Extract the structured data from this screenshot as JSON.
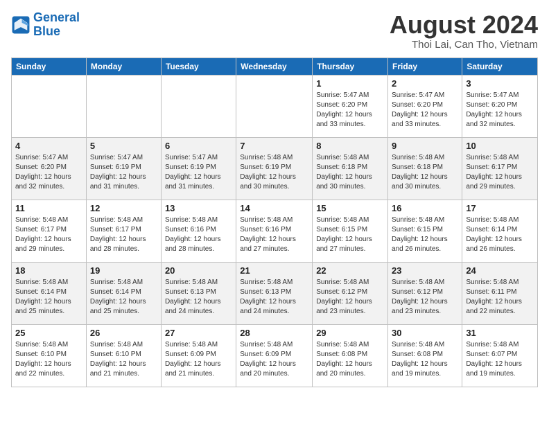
{
  "header": {
    "logo_line1": "General",
    "logo_line2": "Blue",
    "month_year": "August 2024",
    "location": "Thoi Lai, Can Tho, Vietnam"
  },
  "days_of_week": [
    "Sunday",
    "Monday",
    "Tuesday",
    "Wednesday",
    "Thursday",
    "Friday",
    "Saturday"
  ],
  "weeks": [
    [
      {
        "day": "",
        "info": ""
      },
      {
        "day": "",
        "info": ""
      },
      {
        "day": "",
        "info": ""
      },
      {
        "day": "",
        "info": ""
      },
      {
        "day": "1",
        "info": "Sunrise: 5:47 AM\nSunset: 6:20 PM\nDaylight: 12 hours\nand 33 minutes."
      },
      {
        "day": "2",
        "info": "Sunrise: 5:47 AM\nSunset: 6:20 PM\nDaylight: 12 hours\nand 33 minutes."
      },
      {
        "day": "3",
        "info": "Sunrise: 5:47 AM\nSunset: 6:20 PM\nDaylight: 12 hours\nand 32 minutes."
      }
    ],
    [
      {
        "day": "4",
        "info": "Sunrise: 5:47 AM\nSunset: 6:20 PM\nDaylight: 12 hours\nand 32 minutes."
      },
      {
        "day": "5",
        "info": "Sunrise: 5:47 AM\nSunset: 6:19 PM\nDaylight: 12 hours\nand 31 minutes."
      },
      {
        "day": "6",
        "info": "Sunrise: 5:47 AM\nSunset: 6:19 PM\nDaylight: 12 hours\nand 31 minutes."
      },
      {
        "day": "7",
        "info": "Sunrise: 5:48 AM\nSunset: 6:19 PM\nDaylight: 12 hours\nand 30 minutes."
      },
      {
        "day": "8",
        "info": "Sunrise: 5:48 AM\nSunset: 6:18 PM\nDaylight: 12 hours\nand 30 minutes."
      },
      {
        "day": "9",
        "info": "Sunrise: 5:48 AM\nSunset: 6:18 PM\nDaylight: 12 hours\nand 30 minutes."
      },
      {
        "day": "10",
        "info": "Sunrise: 5:48 AM\nSunset: 6:17 PM\nDaylight: 12 hours\nand 29 minutes."
      }
    ],
    [
      {
        "day": "11",
        "info": "Sunrise: 5:48 AM\nSunset: 6:17 PM\nDaylight: 12 hours\nand 29 minutes."
      },
      {
        "day": "12",
        "info": "Sunrise: 5:48 AM\nSunset: 6:17 PM\nDaylight: 12 hours\nand 28 minutes."
      },
      {
        "day": "13",
        "info": "Sunrise: 5:48 AM\nSunset: 6:16 PM\nDaylight: 12 hours\nand 28 minutes."
      },
      {
        "day": "14",
        "info": "Sunrise: 5:48 AM\nSunset: 6:16 PM\nDaylight: 12 hours\nand 27 minutes."
      },
      {
        "day": "15",
        "info": "Sunrise: 5:48 AM\nSunset: 6:15 PM\nDaylight: 12 hours\nand 27 minutes."
      },
      {
        "day": "16",
        "info": "Sunrise: 5:48 AM\nSunset: 6:15 PM\nDaylight: 12 hours\nand 26 minutes."
      },
      {
        "day": "17",
        "info": "Sunrise: 5:48 AM\nSunset: 6:14 PM\nDaylight: 12 hours\nand 26 minutes."
      }
    ],
    [
      {
        "day": "18",
        "info": "Sunrise: 5:48 AM\nSunset: 6:14 PM\nDaylight: 12 hours\nand 25 minutes."
      },
      {
        "day": "19",
        "info": "Sunrise: 5:48 AM\nSunset: 6:14 PM\nDaylight: 12 hours\nand 25 minutes."
      },
      {
        "day": "20",
        "info": "Sunrise: 5:48 AM\nSunset: 6:13 PM\nDaylight: 12 hours\nand 24 minutes."
      },
      {
        "day": "21",
        "info": "Sunrise: 5:48 AM\nSunset: 6:13 PM\nDaylight: 12 hours\nand 24 minutes."
      },
      {
        "day": "22",
        "info": "Sunrise: 5:48 AM\nSunset: 6:12 PM\nDaylight: 12 hours\nand 23 minutes."
      },
      {
        "day": "23",
        "info": "Sunrise: 5:48 AM\nSunset: 6:12 PM\nDaylight: 12 hours\nand 23 minutes."
      },
      {
        "day": "24",
        "info": "Sunrise: 5:48 AM\nSunset: 6:11 PM\nDaylight: 12 hours\nand 22 minutes."
      }
    ],
    [
      {
        "day": "25",
        "info": "Sunrise: 5:48 AM\nSunset: 6:10 PM\nDaylight: 12 hours\nand 22 minutes."
      },
      {
        "day": "26",
        "info": "Sunrise: 5:48 AM\nSunset: 6:10 PM\nDaylight: 12 hours\nand 21 minutes."
      },
      {
        "day": "27",
        "info": "Sunrise: 5:48 AM\nSunset: 6:09 PM\nDaylight: 12 hours\nand 21 minutes."
      },
      {
        "day": "28",
        "info": "Sunrise: 5:48 AM\nSunset: 6:09 PM\nDaylight: 12 hours\nand 20 minutes."
      },
      {
        "day": "29",
        "info": "Sunrise: 5:48 AM\nSunset: 6:08 PM\nDaylight: 12 hours\nand 20 minutes."
      },
      {
        "day": "30",
        "info": "Sunrise: 5:48 AM\nSunset: 6:08 PM\nDaylight: 12 hours\nand 19 minutes."
      },
      {
        "day": "31",
        "info": "Sunrise: 5:48 AM\nSunset: 6:07 PM\nDaylight: 12 hours\nand 19 minutes."
      }
    ]
  ]
}
